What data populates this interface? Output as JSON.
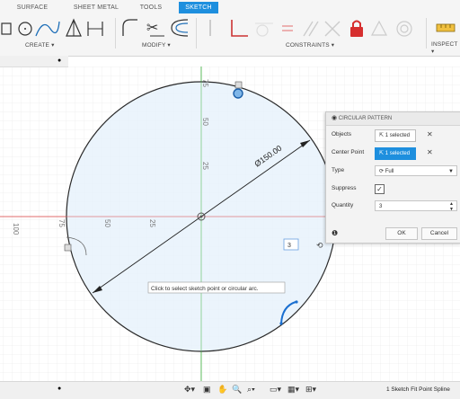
{
  "toolbar": {
    "tabs": [
      "SURFACE",
      "SHEET METAL",
      "TOOLS",
      "SKETCH"
    ],
    "groups": {
      "create": "CREATE ▾",
      "modify": "MODIFY ▾",
      "constraints": "CONSTRAINTS ▾",
      "inspect": "INSPECT ▾"
    }
  },
  "canvas": {
    "dimension_label": "Ø150.00",
    "ruler_labels": {
      "v75": "75",
      "v50": "50",
      "v25": "25",
      "h100": "100",
      "h75": "75",
      "h50": "50",
      "h25": "25"
    },
    "tooltip": "Click to select sketch point or circular arc.",
    "quantity_inline": "3"
  },
  "panel": {
    "title": "CIRCULAR PATTERN",
    "objects_label": "Objects",
    "objects_value": "1 selected",
    "center_label": "Center Point",
    "center_value": "1 selected",
    "type_label": "Type",
    "type_value": "Full",
    "suppress_label": "Suppress",
    "quantity_label": "Quantity",
    "quantity_value": "3",
    "ok": "OK",
    "cancel": "Cancel"
  },
  "status": {
    "text": "1 Sketch Fit Point Spline"
  },
  "colors": {
    "accent": "#1e8fde",
    "circle_fill": "#e8f2fb",
    "axis_red": "#e06b6b",
    "axis_green": "#5cbf5c",
    "selection": "#1a6fd0"
  }
}
